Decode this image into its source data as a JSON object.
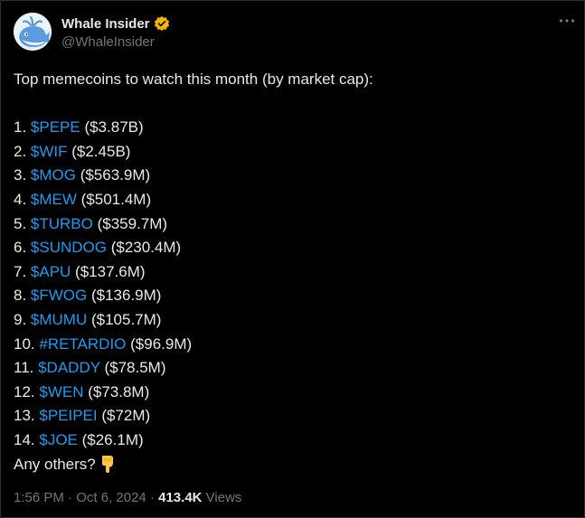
{
  "author": {
    "display_name": "Whale Insider",
    "handle": "@WhaleInsider",
    "avatar_icon": "whale-icon",
    "verified_icon": "verified-badge-icon",
    "verified_color": "#f4b400"
  },
  "more_icon": "more-dots-icon",
  "tweet": {
    "intro": "Top memecoins to watch this month (by market cap):",
    "items": [
      {
        "prefix": "1. ",
        "tag": "$PEPE",
        "value": " ($3.87B)"
      },
      {
        "prefix": "2. ",
        "tag": "$WIF",
        "value": " ($2.45B)"
      },
      {
        "prefix": "3. ",
        "tag": "$MOG",
        "value": " ($563.9M)"
      },
      {
        "prefix": "4. ",
        "tag": "$MEW",
        "value": " ($501.4M)"
      },
      {
        "prefix": "5. ",
        "tag": "$TURBO",
        "value": " ($359.7M)"
      },
      {
        "prefix": "6. ",
        "tag": "$SUNDOG",
        "value": " ($230.4M)"
      },
      {
        "prefix": "7. ",
        "tag": "$APU",
        "value": " ($137.6M)"
      },
      {
        "prefix": "8. ",
        "tag": "$FWOG",
        "value": " ($136.9M)"
      },
      {
        "prefix": "9. ",
        "tag": "$MUMU",
        "value": " ($105.7M)"
      },
      {
        "prefix": "10. ",
        "tag": "#RETARDIO",
        "value": " ($96.9M)"
      },
      {
        "prefix": "11. ",
        "tag": "$DADDY",
        "value": " ($78.5M)"
      },
      {
        "prefix": "12. ",
        "tag": "$WEN",
        "value": " ($73.8M)"
      },
      {
        "prefix": "13. ",
        "tag": "$PEIPEI",
        "value": " ($72M)"
      },
      {
        "prefix": "14. ",
        "tag": "$JOE",
        "value": " ($26.1M)"
      }
    ],
    "outro": "Any others?",
    "outro_emoji": "pointing-down-hand-emoji",
    "link_color": "#1d9bf0"
  },
  "meta": {
    "time": "1:56 PM",
    "separator": " · ",
    "date": "Oct 6, 2024",
    "views_count": "413.4K",
    "views_label": "Views"
  }
}
